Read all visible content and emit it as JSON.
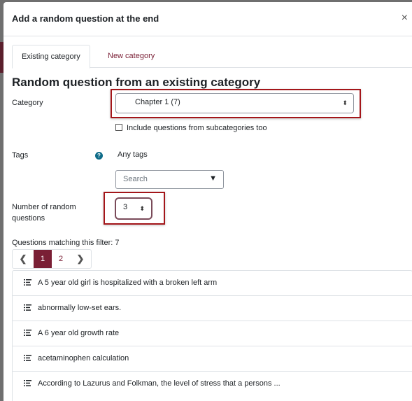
{
  "modal": {
    "title": "Add a random question at the end",
    "close": "×"
  },
  "tabs": [
    {
      "label": "Existing category"
    },
    {
      "label": "New category"
    }
  ],
  "section_heading": "Random question from an existing category",
  "category": {
    "label": "Category",
    "value": "Chapter 1 (7)",
    "arrows": "⬍"
  },
  "subcategories": {
    "label": "Include questions from subcategories too"
  },
  "tags": {
    "label": "Tags",
    "help": "?",
    "current": "Any tags",
    "search_placeholder": "Search",
    "dropdown": "▼"
  },
  "random_count": {
    "label": "Number of random questions",
    "value": "3",
    "arrows": "⬍"
  },
  "filter_summary": "Questions matching this filter: 7",
  "pagination": {
    "prev": "❮",
    "pages": [
      "1",
      "2"
    ],
    "next": "❯"
  },
  "questions": [
    {
      "text": "A 5 year old girl is hospitalized with a broken left arm"
    },
    {
      "text": "abnormally low-set ears."
    },
    {
      "text": "A 6 year old growth rate"
    },
    {
      "text": "acetaminophen calculation"
    },
    {
      "text": "According to Lazurus and Folkman, the level of stress that a persons ..."
    }
  ],
  "colors": {
    "accent": "#7a1f35",
    "highlight": "#a4161a",
    "help": "#0f6c89"
  }
}
